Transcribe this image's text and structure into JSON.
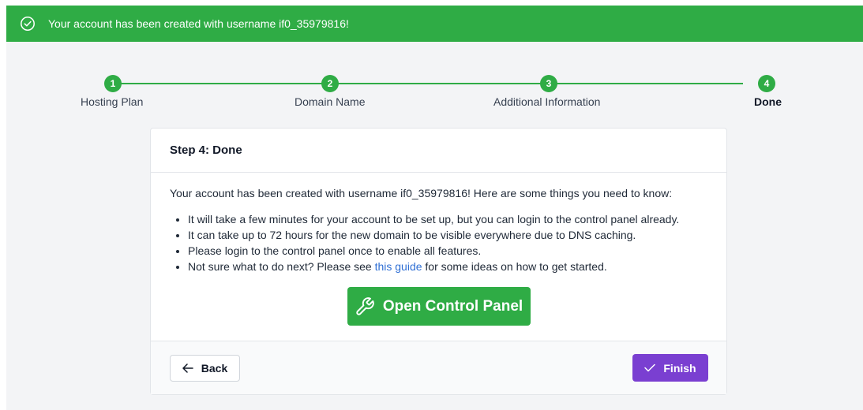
{
  "alert": {
    "message": "Your account has been created with username if0_35979816!",
    "icon": "check-circle-icon",
    "color": "#2fac45"
  },
  "stepper": {
    "steps": [
      {
        "number": "1",
        "label": "Hosting Plan",
        "active": false
      },
      {
        "number": "2",
        "label": "Domain Name",
        "active": false
      },
      {
        "number": "3",
        "label": "Additional Information",
        "active": false
      },
      {
        "number": "4",
        "label": "Done",
        "active": true
      }
    ]
  },
  "card": {
    "title": "Step 4: Done",
    "intro": "Your account has been created with username if0_35979816! Here are some things you need to know:",
    "bullets": [
      "It will take a few minutes for your account to be set up, but you can login to the control panel already.",
      "It can take up to 72 hours for the new domain to be visible everywhere due to DNS caching.",
      "Please login to the control panel once to enable all features."
    ],
    "last_bullet": {
      "before": "Not sure what to do next? Please see ",
      "link": "this guide",
      "after": " for some ideas on how to get started."
    },
    "control_panel_label": "Open Control Panel"
  },
  "footer": {
    "back_label": "Back",
    "finish_label": "Finish"
  },
  "colors": {
    "accent_green": "#2fac45",
    "finish_purple": "#7a3fd1",
    "link_blue": "#2f6fd4"
  }
}
